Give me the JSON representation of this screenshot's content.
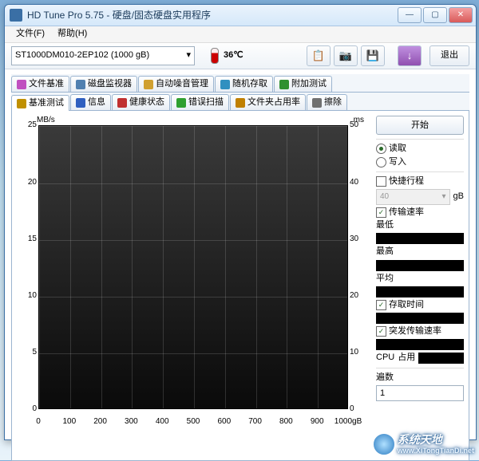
{
  "window": {
    "title": "HD Tune Pro 5.75 - 硬盘/固态硬盘实用程序"
  },
  "menu": {
    "file": "文件(F)",
    "help": "帮助(H)"
  },
  "toolbar": {
    "drive": "ST1000DM010-2EP102 (1000 gB)",
    "temp": "36℃",
    "exit": "退出"
  },
  "tabs_upper": [
    {
      "label": "文件基准",
      "icon": "#c050c0"
    },
    {
      "label": "磁盘监视器",
      "icon": "#5080b0"
    },
    {
      "label": "自动噪音管理",
      "icon": "#d0a030"
    },
    {
      "label": "随机存取",
      "icon": "#3090c0"
    },
    {
      "label": "附加测试",
      "icon": "#309030"
    }
  ],
  "tabs_lower": [
    {
      "label": "基准测试",
      "icon": "#c09000",
      "active": true
    },
    {
      "label": "信息",
      "icon": "#3060c0"
    },
    {
      "label": "健康状态",
      "icon": "#c03030"
    },
    {
      "label": "错误扫描",
      "icon": "#30a030"
    },
    {
      "label": "文件夹占用率",
      "icon": "#c08000"
    },
    {
      "label": "擦除",
      "icon": "#707070"
    }
  ],
  "chart_data": {
    "type": "line",
    "title": "",
    "xlabel": "gB",
    "ylabel_left": "MB/s",
    "ylabel_right": "ms",
    "x_ticks": [
      0,
      100,
      200,
      300,
      400,
      500,
      600,
      700,
      800,
      900,
      1000
    ],
    "y_ticks_left": [
      0,
      5,
      10,
      15,
      20,
      25
    ],
    "y_ticks_right": [
      0,
      10,
      20,
      30,
      40,
      50
    ],
    "ylim": [
      0,
      25
    ],
    "ylim_right": [
      0,
      50
    ],
    "xlim": [
      0,
      1000
    ],
    "series": []
  },
  "side": {
    "start": "开始",
    "read": "读取",
    "write": "写入",
    "short_stroke": "快捷行程",
    "short_stroke_value": "40",
    "gb": "gB",
    "transfer_rate": "传输速率",
    "min": "最低",
    "max": "最高",
    "avg": "平均",
    "access_time": "存取时间",
    "burst_rate": "突发传输速率",
    "cpu": "CPU",
    "cpu_usage": "占用",
    "passes": "遍数",
    "passes_value": "1"
  },
  "watermark": {
    "text": "系统天地",
    "url": "www.XiTongTianDi.net"
  },
  "x_right_unit": "1000gB"
}
